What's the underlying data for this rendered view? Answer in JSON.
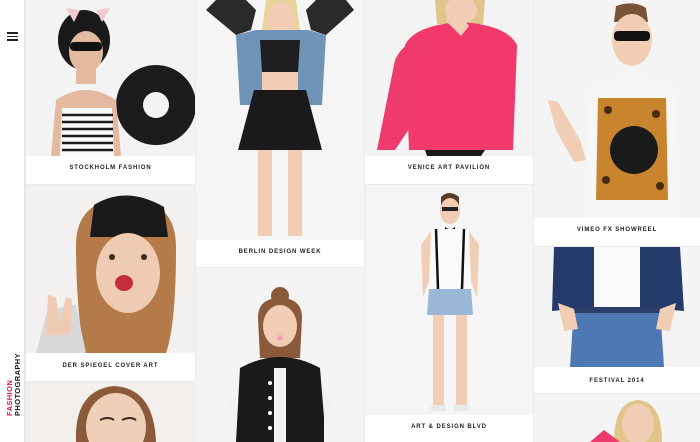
{
  "brand": {
    "line1": "FASHION",
    "line2": "PHOTOGRAPHY"
  },
  "menu": {
    "icon": "hamburger-icon"
  },
  "cards": [
    {
      "id": "stockholm",
      "caption": "STOCKHOLM FASHION"
    },
    {
      "id": "berlin",
      "caption": "BERLIN DESIGN WEEK"
    },
    {
      "id": "venice",
      "caption": "VENICE ART PAVILION"
    },
    {
      "id": "vimeo",
      "caption": "VIMEO FX SHOWREEL"
    },
    {
      "id": "spiegel",
      "caption": "DER SPIEGEL COVER ART"
    },
    {
      "id": "artdesign",
      "caption": "ART & DESIGN BLVD"
    },
    {
      "id": "festival",
      "caption": "FESTIVAL 2014"
    }
  ],
  "colors": {
    "accent": "#e5125b",
    "text": "#222222",
    "background": "#ebebeb"
  }
}
